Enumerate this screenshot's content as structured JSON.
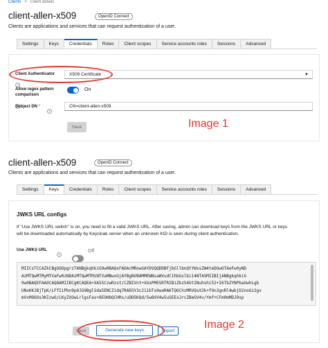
{
  "breadcrumb": {
    "root": "Clients",
    "separator": ">",
    "current": "Client details"
  },
  "shot1": {
    "title": "client-allen-x509",
    "badge": "OpenID Connect",
    "description": "Clients are applications and services that can request authentication of a user.",
    "tabs": [
      "Settings",
      "Keys",
      "Credentials",
      "Roles",
      "Client scopes",
      "Service accounts roles",
      "Sessions",
      "Advanced"
    ],
    "active_tab": "Credentials",
    "client_authenticator_label": "Client Authenticator",
    "client_authenticator_value": "X509 Certificate",
    "regex_label_1": "Allow regex pattern",
    "regex_label_2": "comparison",
    "regex_toggle_text": "On",
    "regex_toggle_on": true,
    "subject_dn_label": "Subject DN",
    "required_mark": "*",
    "subject_dn_value": "CN=client-allen-x509",
    "save_label": "Save",
    "annotation": "Image 1"
  },
  "shot2": {
    "title": "client-allen-x509",
    "badge": "OpenID Connect",
    "description": "Clients are applications and services that can request authentication of a user.",
    "tabs": [
      "Settings",
      "Keys",
      "Credentials",
      "Roles",
      "Client scopes",
      "Service accounts roles",
      "Sessions",
      "Advanced"
    ],
    "active_tab": "Keys",
    "section_title": "JWKS URL configs",
    "info_line_1": "If \"Use JWKS URL switch\" is on, you need to fill a valid JWKS URL. After saving, admin can download keys from the JWKS URL or keys",
    "info_line_2": "will be downloaded automatically by Keycloak server when an unknown KID is seen during client authentication.",
    "use_jwks_label": "Use JWKS URL",
    "use_jwks_toggle_text": "Off",
    "use_jwks_on": false,
    "cert_lines": [
      "MIICsTCCAZkCBgGOOpgrzTANBgkqhkiG9w0BAQsFADAcMRowGAYDVQQDDBFjbGllbnQtYWxsZW4teDUwOTAeFw0yND",
      "AzMTQwMTMyMTVaFw0zNDAzMTQwMTMzNTVaMBwxGjAYBgNVBAMMEWNsaWVudC1hbGxlbi14NTA5MIIBIjANBgkqhkiG",
      "9w0BAQEFAAOCAQ8AMIIBCgKCAQEA+XA55CzwRzst/CZBIVnt+XGsPMESRTRIBiZkz54UtINuhshi52+I6TbZYNPbaUwhLgb",
      "UNxKKJBjTpK/LFfIiPbn9p0JG9BglSda5ENCZidq7RAEGY3c211bTs0waRAKTQOChzMRVQsX2k+fOn3gnRl4wbjD2noGz2gv",
      "mVxMOOOs3KIzwO/LKyZXOwLrlgsFas+8EOHbQCHRs/uDD5KQd/5w8XV4w5uSEExJrcZBeGV4v/Ymf+CFm0mMDJ9sp"
    ],
    "save_label": "Save",
    "generate_label": "Generate new keys",
    "import_label": "Import",
    "annotation": "Image 2"
  },
  "colors": {
    "brand_blue": "#0066cc",
    "annotation_red": "#e0362c",
    "toggle_off": "#8a8d90"
  }
}
